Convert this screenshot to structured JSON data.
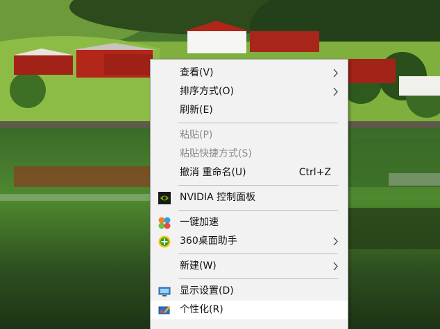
{
  "context_menu": {
    "items": [
      {
        "label": "查看(V)",
        "submenu": true
      },
      {
        "label": "排序方式(O)",
        "submenu": true
      },
      {
        "label": "刷新(E)"
      },
      {
        "label": "粘贴(P)",
        "disabled": true
      },
      {
        "label": "粘贴快捷方式(S)",
        "disabled": true
      },
      {
        "label": "撤消 重命名(U)",
        "shortcut": "Ctrl+Z"
      },
      {
        "label": "NVIDIA 控制面板",
        "icon": "nvidia-icon"
      },
      {
        "label": "一键加速",
        "icon": "speedup-icon"
      },
      {
        "label": "360桌面助手",
        "icon": "360-desktop-icon",
        "submenu": true
      },
      {
        "label": "新建(W)",
        "submenu": true
      },
      {
        "label": "显示设置(D)",
        "icon": "display-icon"
      },
      {
        "label": "个性化(R)",
        "icon": "personalize-icon"
      }
    ]
  },
  "colors": {
    "menu_background": "#f2f2f2",
    "disabled_text": "#8a8a8a",
    "nvidia_green": "#76b900"
  }
}
